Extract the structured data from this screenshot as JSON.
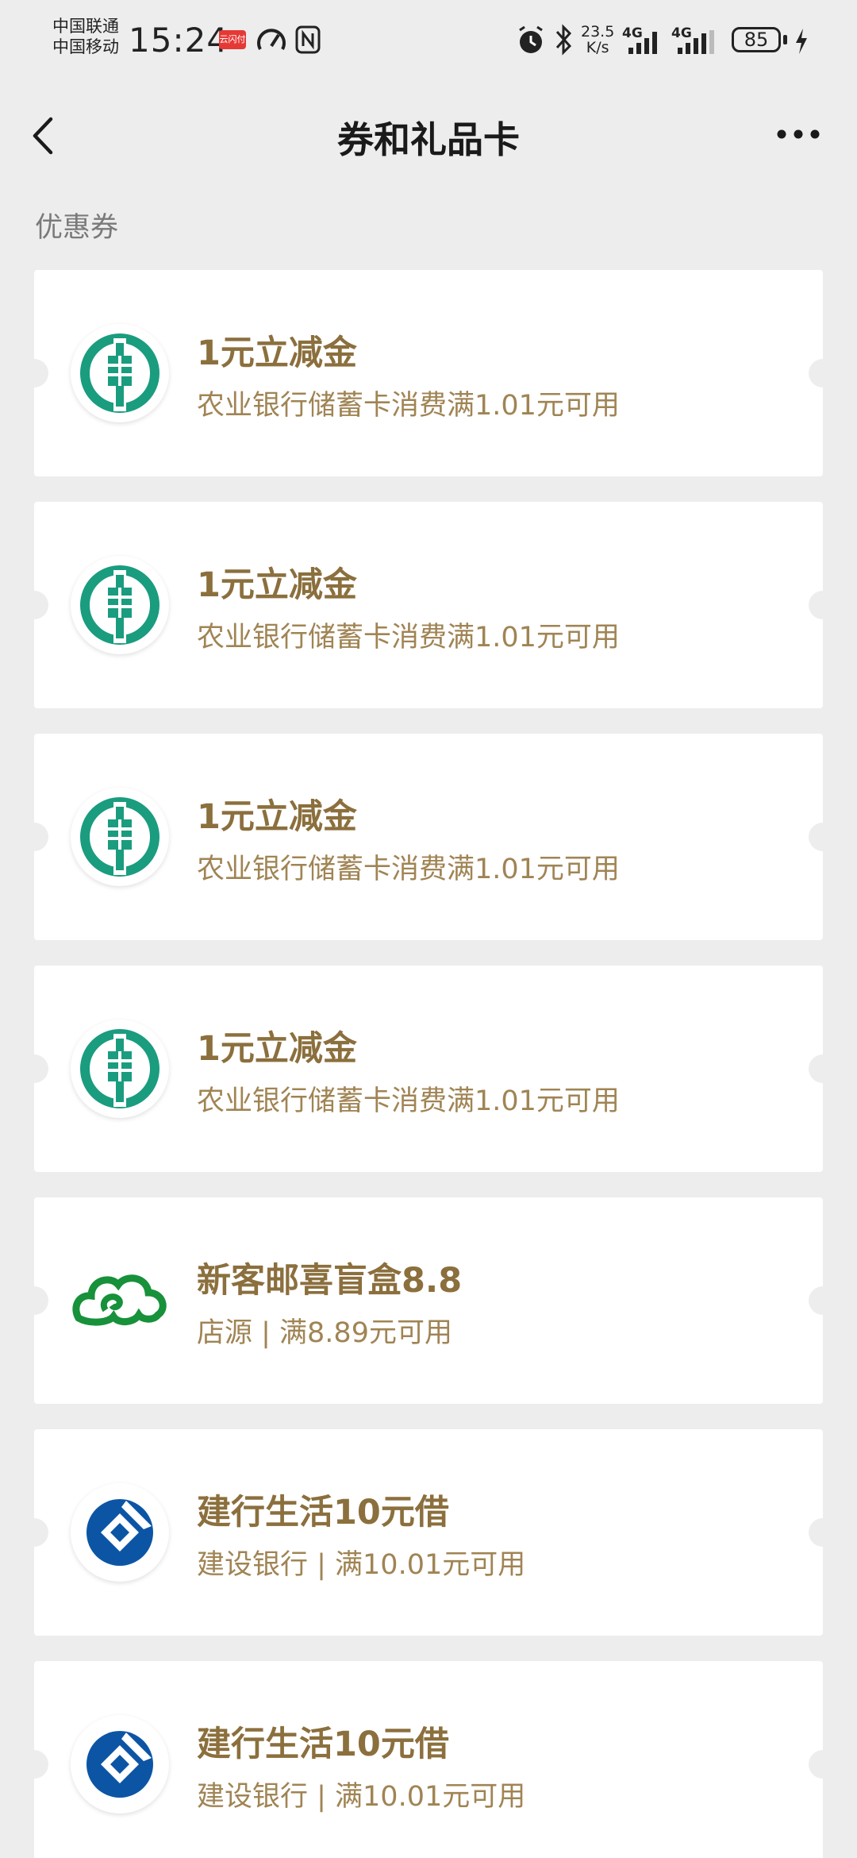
{
  "status_bar": {
    "carrier_1": "中国联通",
    "carrier_2": "中国移动",
    "time": "15:24",
    "app_badge": "云闪付",
    "net_speed_value": "23.5",
    "net_speed_unit": "K/s",
    "network_1": "4G",
    "network_2": "4G",
    "battery": "85"
  },
  "header": {
    "title": "券和礼品卡"
  },
  "section": {
    "label": "优惠券"
  },
  "coupons": [
    {
      "name": "1元立减金",
      "desc": "农业银行储蓄卡消费满1.01元可用",
      "logo": "abc-bank-logo-icon"
    },
    {
      "name": "1元立减金",
      "desc": "农业银行储蓄卡消费满1.01元可用",
      "logo": "abc-bank-logo-icon"
    },
    {
      "name": "1元立减金",
      "desc": "农业银行储蓄卡消费满1.01元可用",
      "logo": "abc-bank-logo-icon"
    },
    {
      "name": "1元立减金",
      "desc": "农业银行储蓄卡消费满1.01元可用",
      "logo": "abc-bank-logo-icon"
    },
    {
      "name": "新客邮喜盲盒8.8",
      "desc": "店源 | 满8.89元可用",
      "logo": "postal-cloud-logo-icon"
    },
    {
      "name": "建行生活10元借",
      "desc": "建设银行 | 满10.01元可用",
      "logo": "ccb-bank-logo-icon"
    },
    {
      "name": "建行生活10元借",
      "desc": "建设银行 | 满10.01元可用",
      "logo": "ccb-bank-logo-icon"
    }
  ],
  "colors": {
    "background": "#ededed",
    "card": "#ffffff",
    "coupon_title": "#8b6f3d",
    "coupon_desc": "#a08454",
    "abc_green": "#1a9c7f",
    "postal_green": "#17913a",
    "ccb_blue": "#0c55a5"
  }
}
